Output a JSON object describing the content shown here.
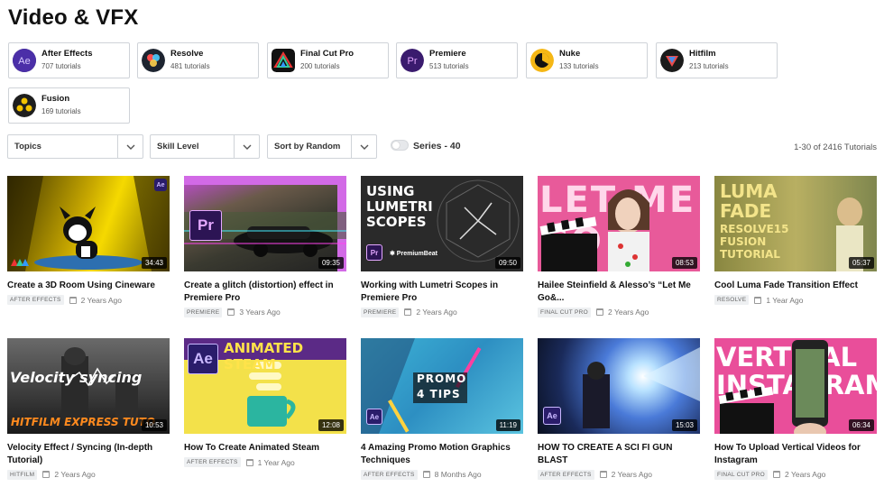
{
  "page": {
    "title": "Video & VFX"
  },
  "software": [
    {
      "name": "After Effects",
      "count": "707 tutorials",
      "icon": "after-effects-icon",
      "abbr": "Ae",
      "bg": "#2a1d6b",
      "fg": "#c9b8ff"
    },
    {
      "name": "Resolve",
      "count": "481 tutorials",
      "icon": "resolve-icon",
      "abbr": "",
      "bg": "#1d2430",
      "fg": "#ffffff"
    },
    {
      "name": "Final Cut Pro",
      "count": "200 tutorials",
      "icon": "final-cut-pro-icon",
      "abbr": "",
      "bg": "#111111",
      "fg": "#ffffff"
    },
    {
      "name": "Premiere",
      "count": "513 tutorials",
      "icon": "premiere-icon",
      "abbr": "Pr",
      "bg": "#2c1454",
      "fg": "#e4a8ff"
    },
    {
      "name": "Nuke",
      "count": "133 tutorials",
      "icon": "nuke-icon",
      "abbr": "",
      "bg": "#f5b715",
      "fg": "#111111"
    },
    {
      "name": "Hitfilm",
      "count": "213 tutorials",
      "icon": "hitfilm-icon",
      "abbr": "",
      "bg": "#1b1b1b",
      "fg": "#ffffff"
    },
    {
      "name": "Fusion",
      "count": "169 tutorials",
      "icon": "fusion-icon",
      "abbr": "",
      "bg": "#1e1e1e",
      "fg": "#f2c200"
    }
  ],
  "filters": {
    "topics": "Topics",
    "skill": "Skill Level",
    "sort": "Sort by Random",
    "series_label": "Series - 40",
    "results": "1-30 of 2416 Tutorials"
  },
  "tutorials": [
    {
      "title": "Create a 3D Room Using Cineware",
      "tag": "AFTER EFFECTS",
      "date": "2 Years Ago",
      "duration": "34:43",
      "thumb_text": "",
      "badge": "Ae"
    },
    {
      "title": "Create a glitch (distortion) effect in Premiere Pro",
      "tag": "PREMIERE",
      "date": "3 Years Ago",
      "duration": "09:35",
      "thumb_text": "",
      "badge": "Pr"
    },
    {
      "title": "Working with Lumetri Scopes in Premiere Pro",
      "tag": "PREMIERE",
      "date": "2 Years Ago",
      "duration": "09:50",
      "thumb_text": "USING LUMETRI SCOPES",
      "badge": "Pr"
    },
    {
      "title": "Hailee Steinfield & Alesso’s “Let Me Go&...",
      "tag": "FINAL CUT PRO",
      "date": "2 Years Ago",
      "duration": "08:53",
      "thumb_text": "LET ME GO",
      "badge": ""
    },
    {
      "title": "Cool Luma Fade Transition Effect",
      "tag": "RESOLVE",
      "date": "1 Year Ago",
      "duration": "05:37",
      "thumb_text": "LUMA FADE",
      "thumb_text2": "RESOLVE15 FUSION TUTORIAL",
      "badge": ""
    },
    {
      "title": "Velocity Effect / Syncing (In-depth Tutorial)",
      "tag": "HITFILM",
      "date": "2 Years Ago",
      "duration": "10:53",
      "thumb_text": "Velocity syncing",
      "thumb_text2": "HITFILM EXPRESS TUTO",
      "badge": ""
    },
    {
      "title": "How To Create Animated Steam",
      "tag": "AFTER EFFECTS",
      "date": "1 Year Ago",
      "duration": "12:08",
      "thumb_text": "ANIMATED STEAM",
      "badge": "Ae"
    },
    {
      "title": "4 Amazing Promo Motion Graphics Techniques",
      "tag": "AFTER EFFECTS",
      "date": "8 Months Ago",
      "duration": "11:19",
      "thumb_text": "PROMO",
      "thumb_text2": "4 TIPS",
      "badge": "Ae"
    },
    {
      "title": "HOW TO CREATE A SCI FI GUN BLAST",
      "tag": "AFTER EFFECTS",
      "date": "2 Years Ago",
      "duration": "15:03",
      "thumb_text": "",
      "badge": "Ae"
    },
    {
      "title": "How To Upload Vertical Videos for Instagram",
      "tag": "FINAL CUT PRO",
      "date": "2 Years Ago",
      "duration": "06:34",
      "thumb_text": "VERTICAL INSTAGRAM",
      "badge": ""
    }
  ]
}
